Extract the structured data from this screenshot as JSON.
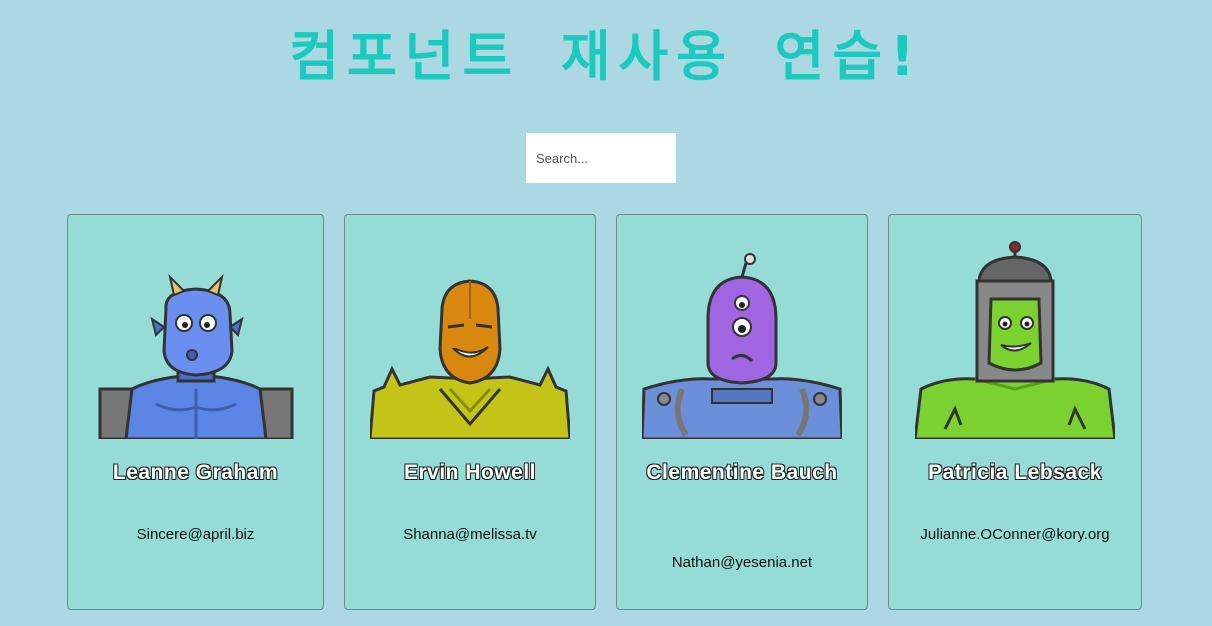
{
  "page": {
    "title": "컴포넌트 재사용 연습!"
  },
  "search": {
    "placeholder": "Search..."
  },
  "robots": [
    {
      "name": "Leanne Graham",
      "email": "Sincere@april.biz",
      "avatar": "blue-horned-robot-icon",
      "color": "#5b86e5"
    },
    {
      "name": "Ervin Howell",
      "email": "Shanna@melissa.tv",
      "avatar": "orange-spiked-robot-icon",
      "color": "#d9880f"
    },
    {
      "name": "Clementine Bauch",
      "email": "Nathan@yesenia.net",
      "avatar": "purple-cyclops-robot-icon",
      "color": "#a065e0"
    },
    {
      "name": "Patricia Lebsack",
      "email": "Julianne.OConner@kory.org",
      "avatar": "green-helmet-robot-icon",
      "color": "#7bd12f"
    }
  ]
}
